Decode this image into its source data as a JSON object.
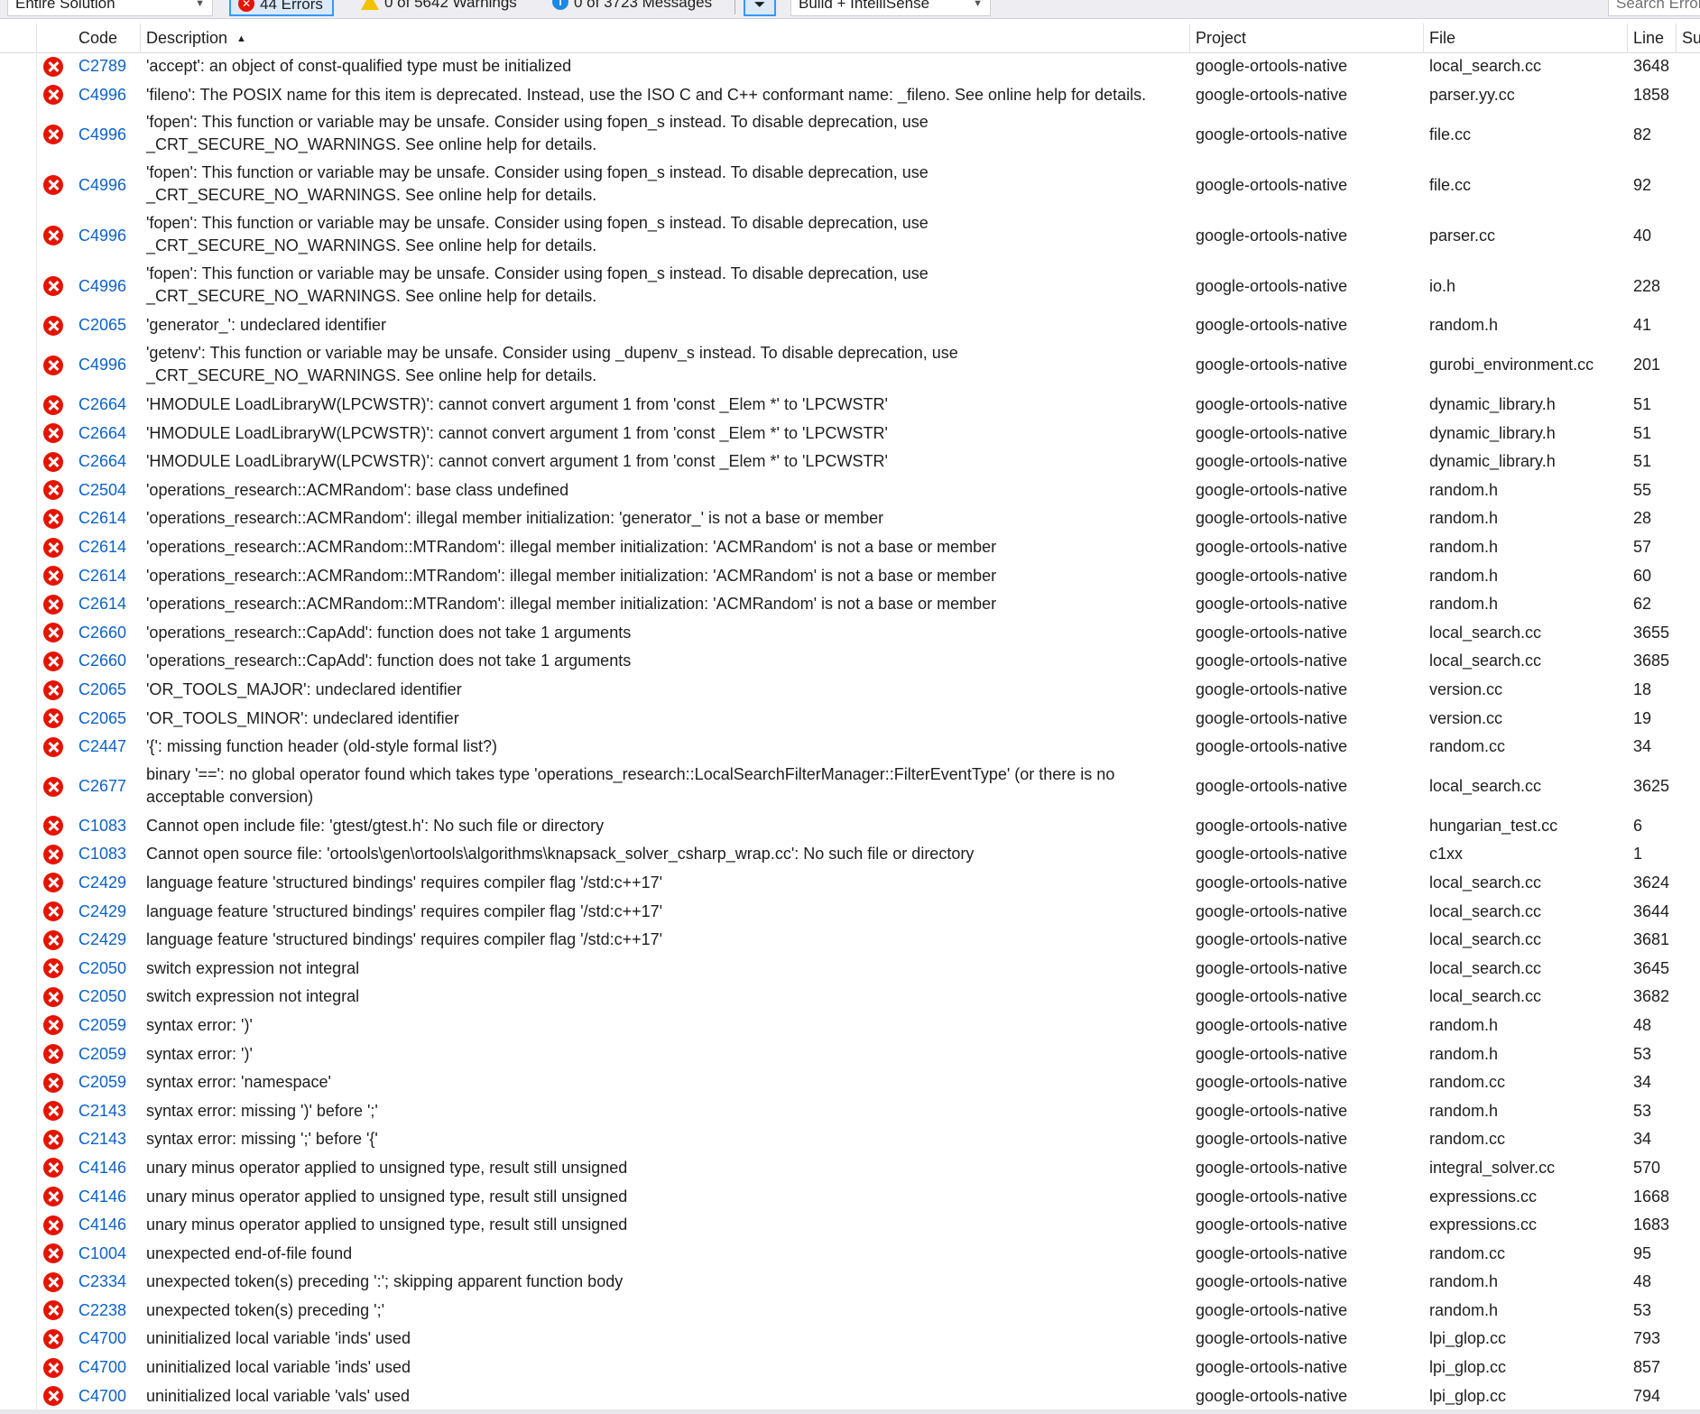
{
  "toolbar": {
    "scope": "Entire Solution",
    "errors": "44 Errors",
    "warnings": "0 of 5642 Warnings",
    "messages": "0 of 3723 Messages",
    "build_filter": "Build + IntelliSense",
    "search_placeholder": "Search Error List"
  },
  "columns": {
    "code": "Code",
    "description": "Description",
    "project": "Project",
    "file": "File",
    "line": "Line",
    "suppression": "Su"
  },
  "rows": [
    {
      "code": "C2789",
      "desc": "'accept': an object of const-qualified type must be initialized",
      "project": "google-ortools-native",
      "file": "local_search.cc",
      "line": "3648"
    },
    {
      "code": "C4996",
      "desc": "'fileno': The POSIX name for this item is deprecated. Instead, use the ISO C and C++ conformant name: _fileno. See online help for details.",
      "project": "google-ortools-native",
      "file": "parser.yy.cc",
      "line": "1858"
    },
    {
      "code": "C4996",
      "desc": "'fopen': This function or variable may be unsafe. Consider using fopen_s instead. To disable deprecation, use _CRT_SECURE_NO_WARNINGS. See online help for details.",
      "project": "google-ortools-native",
      "file": "file.cc",
      "line": "82"
    },
    {
      "code": "C4996",
      "desc": "'fopen': This function or variable may be unsafe. Consider using fopen_s instead. To disable deprecation, use _CRT_SECURE_NO_WARNINGS. See online help for details.",
      "project": "google-ortools-native",
      "file": "file.cc",
      "line": "92"
    },
    {
      "code": "C4996",
      "desc": "'fopen': This function or variable may be unsafe. Consider using fopen_s instead. To disable deprecation, use _CRT_SECURE_NO_WARNINGS. See online help for details.",
      "project": "google-ortools-native",
      "file": "parser.cc",
      "line": "40"
    },
    {
      "code": "C4996",
      "desc": "'fopen': This function or variable may be unsafe. Consider using fopen_s instead. To disable deprecation, use _CRT_SECURE_NO_WARNINGS. See online help for details.",
      "project": "google-ortools-native",
      "file": "io.h",
      "line": "228"
    },
    {
      "code": "C2065",
      "desc": "'generator_': undeclared identifier",
      "project": "google-ortools-native",
      "file": "random.h",
      "line": "41"
    },
    {
      "code": "C4996",
      "desc": "'getenv': This function or variable may be unsafe. Consider using _dupenv_s instead. To disable deprecation, use _CRT_SECURE_NO_WARNINGS. See online help for details.",
      "project": "google-ortools-native",
      "file": "gurobi_environment.cc",
      "line": "201"
    },
    {
      "code": "C2664",
      "desc": "'HMODULE LoadLibraryW(LPCWSTR)': cannot convert argument 1 from 'const _Elem *' to 'LPCWSTR'",
      "project": "google-ortools-native",
      "file": "dynamic_library.h",
      "line": "51"
    },
    {
      "code": "C2664",
      "desc": "'HMODULE LoadLibraryW(LPCWSTR)': cannot convert argument 1 from 'const _Elem *' to 'LPCWSTR'",
      "project": "google-ortools-native",
      "file": "dynamic_library.h",
      "line": "51"
    },
    {
      "code": "C2664",
      "desc": "'HMODULE LoadLibraryW(LPCWSTR)': cannot convert argument 1 from 'const _Elem *' to 'LPCWSTR'",
      "project": "google-ortools-native",
      "file": "dynamic_library.h",
      "line": "51"
    },
    {
      "code": "C2504",
      "desc": "'operations_research::ACMRandom': base class undefined",
      "project": "google-ortools-native",
      "file": "random.h",
      "line": "55"
    },
    {
      "code": "C2614",
      "desc": "'operations_research::ACMRandom': illegal member initialization: 'generator_' is not a base or member",
      "project": "google-ortools-native",
      "file": "random.h",
      "line": "28"
    },
    {
      "code": "C2614",
      "desc": "'operations_research::ACMRandom::MTRandom': illegal member initialization: 'ACMRandom' is not a base or member",
      "project": "google-ortools-native",
      "file": "random.h",
      "line": "57"
    },
    {
      "code": "C2614",
      "desc": "'operations_research::ACMRandom::MTRandom': illegal member initialization: 'ACMRandom' is not a base or member",
      "project": "google-ortools-native",
      "file": "random.h",
      "line": "60"
    },
    {
      "code": "C2614",
      "desc": "'operations_research::ACMRandom::MTRandom': illegal member initialization: 'ACMRandom' is not a base or member",
      "project": "google-ortools-native",
      "file": "random.h",
      "line": "62"
    },
    {
      "code": "C2660",
      "desc": "'operations_research::CapAdd': function does not take 1 arguments",
      "project": "google-ortools-native",
      "file": "local_search.cc",
      "line": "3655"
    },
    {
      "code": "C2660",
      "desc": "'operations_research::CapAdd': function does not take 1 arguments",
      "project": "google-ortools-native",
      "file": "local_search.cc",
      "line": "3685"
    },
    {
      "code": "C2065",
      "desc": "'OR_TOOLS_MAJOR': undeclared identifier",
      "project": "google-ortools-native",
      "file": "version.cc",
      "line": "18"
    },
    {
      "code": "C2065",
      "desc": "'OR_TOOLS_MINOR': undeclared identifier",
      "project": "google-ortools-native",
      "file": "version.cc",
      "line": "19"
    },
    {
      "code": "C2447",
      "desc": "'{': missing function header (old-style formal list?)",
      "project": "google-ortools-native",
      "file": "random.cc",
      "line": "34"
    },
    {
      "code": "C2677",
      "desc": "binary '==': no global operator found which takes type 'operations_research::LocalSearchFilterManager::FilterEventType' (or there is no acceptable conversion)",
      "project": "google-ortools-native",
      "file": "local_search.cc",
      "line": "3625"
    },
    {
      "code": "C1083",
      "desc": "Cannot open include file: 'gtest/gtest.h': No such file or directory",
      "project": "google-ortools-native",
      "file": "hungarian_test.cc",
      "line": "6"
    },
    {
      "code": "C1083",
      "desc": "Cannot open source file: 'ortools\\gen\\ortools\\algorithms\\knapsack_solver_csharp_wrap.cc': No such file or directory",
      "project": "google-ortools-native",
      "file": "c1xx",
      "line": "1"
    },
    {
      "code": "C2429",
      "desc": "language feature 'structured bindings' requires compiler flag '/std:c++17'",
      "project": "google-ortools-native",
      "file": "local_search.cc",
      "line": "3624"
    },
    {
      "code": "C2429",
      "desc": "language feature 'structured bindings' requires compiler flag '/std:c++17'",
      "project": "google-ortools-native",
      "file": "local_search.cc",
      "line": "3644"
    },
    {
      "code": "C2429",
      "desc": "language feature 'structured bindings' requires compiler flag '/std:c++17'",
      "project": "google-ortools-native",
      "file": "local_search.cc",
      "line": "3681"
    },
    {
      "code": "C2050",
      "desc": "switch expression not integral",
      "project": "google-ortools-native",
      "file": "local_search.cc",
      "line": "3645"
    },
    {
      "code": "C2050",
      "desc": "switch expression not integral",
      "project": "google-ortools-native",
      "file": "local_search.cc",
      "line": "3682"
    },
    {
      "code": "C2059",
      "desc": "syntax error: ')'",
      "project": "google-ortools-native",
      "file": "random.h",
      "line": "48"
    },
    {
      "code": "C2059",
      "desc": "syntax error: ')'",
      "project": "google-ortools-native",
      "file": "random.h",
      "line": "53"
    },
    {
      "code": "C2059",
      "desc": "syntax error: 'namespace'",
      "project": "google-ortools-native",
      "file": "random.cc",
      "line": "34"
    },
    {
      "code": "C2143",
      "desc": "syntax error: missing ')' before ';'",
      "project": "google-ortools-native",
      "file": "random.h",
      "line": "53"
    },
    {
      "code": "C2143",
      "desc": "syntax error: missing ';' before '{'",
      "project": "google-ortools-native",
      "file": "random.cc",
      "line": "34"
    },
    {
      "code": "C4146",
      "desc": "unary minus operator applied to unsigned type, result still unsigned",
      "project": "google-ortools-native",
      "file": "integral_solver.cc",
      "line": "570"
    },
    {
      "code": "C4146",
      "desc": "unary minus operator applied to unsigned type, result still unsigned",
      "project": "google-ortools-native",
      "file": "expressions.cc",
      "line": "1668"
    },
    {
      "code": "C4146",
      "desc": "unary minus operator applied to unsigned type, result still unsigned",
      "project": "google-ortools-native",
      "file": "expressions.cc",
      "line": "1683"
    },
    {
      "code": "C1004",
      "desc": "unexpected end-of-file found",
      "project": "google-ortools-native",
      "file": "random.cc",
      "line": "95"
    },
    {
      "code": "C2334",
      "desc": "unexpected token(s) preceding ':'; skipping apparent function body",
      "project": "google-ortools-native",
      "file": "random.h",
      "line": "48"
    },
    {
      "code": "C2238",
      "desc": "unexpected token(s) preceding ';'",
      "project": "google-ortools-native",
      "file": "random.h",
      "line": "53"
    },
    {
      "code": "C4700",
      "desc": "uninitialized local variable 'inds' used",
      "project": "google-ortools-native",
      "file": "lpi_glop.cc",
      "line": "793"
    },
    {
      "code": "C4700",
      "desc": "uninitialized local variable 'inds' used",
      "project": "google-ortools-native",
      "file": "lpi_glop.cc",
      "line": "857"
    },
    {
      "code": "C4700",
      "desc": "uninitialized local variable 'vals' used",
      "project": "google-ortools-native",
      "file": "lpi_glop.cc",
      "line": "794"
    }
  ]
}
